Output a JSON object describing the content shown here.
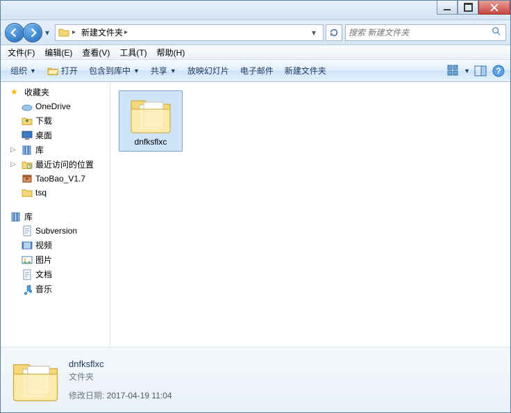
{
  "titlebar": {},
  "nav": {
    "breadcrumb": [
      "新建文件夹"
    ],
    "search_placeholder": "搜索 新建文件夹"
  },
  "menu": {
    "file": "文件(F)",
    "edit": "编辑(E)",
    "view": "查看(V)",
    "tools": "工具(T)",
    "help": "帮助(H)"
  },
  "toolbar": {
    "organize": "组织",
    "open": "打开",
    "include": "包含到库中",
    "share": "共享",
    "slideshow": "放映幻灯片",
    "email": "电子邮件",
    "newfolder": "新建文件夹"
  },
  "sidebar": {
    "favorites": {
      "label": "收藏夹",
      "items": [
        {
          "label": "OneDrive",
          "icon": "onedrive"
        },
        {
          "label": "下载",
          "icon": "downloads"
        },
        {
          "label": "桌面",
          "icon": "desktop"
        },
        {
          "label": "库",
          "icon": "library",
          "twisty": true
        },
        {
          "label": "最近访问的位置",
          "icon": "recent",
          "twisty": true
        },
        {
          "label": "TaoBao_V1.7",
          "icon": "archive"
        },
        {
          "label": "tsq",
          "icon": "folder"
        }
      ]
    },
    "libraries": {
      "label": "库",
      "items": [
        {
          "label": "Subversion",
          "icon": "doc"
        },
        {
          "label": "视频",
          "icon": "video"
        },
        {
          "label": "图片",
          "icon": "pictures"
        },
        {
          "label": "文档",
          "icon": "doc"
        },
        {
          "label": "音乐",
          "icon": "music"
        }
      ]
    }
  },
  "content": {
    "items": [
      {
        "label": "dnfksflxc",
        "type": "folder",
        "selected": true
      }
    ]
  },
  "details": {
    "name": "dnfksflxc",
    "type": "文件夹",
    "modified_label": "修改日期:",
    "modified_value": "2017-04-19 11:04"
  }
}
